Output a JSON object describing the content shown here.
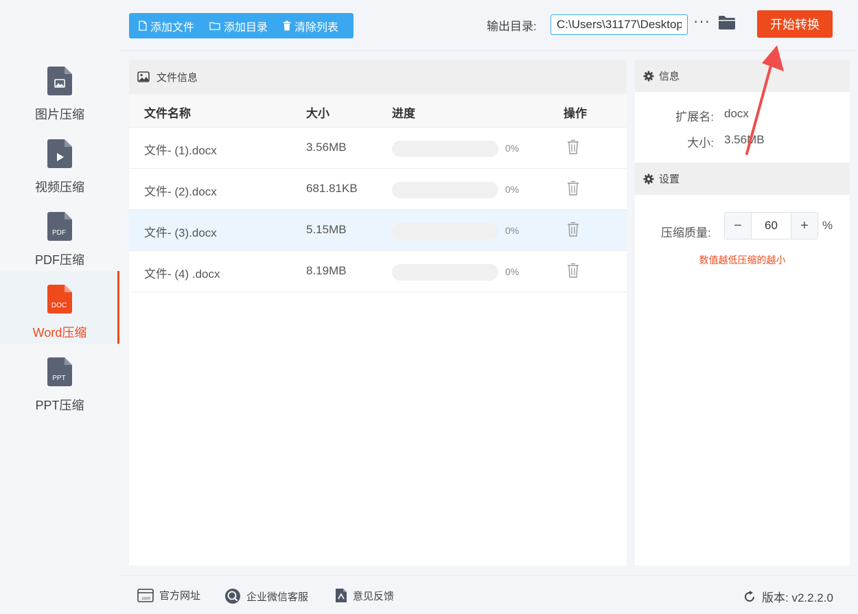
{
  "sidebar": {
    "items": [
      {
        "label": "图片压缩",
        "icon_text": "",
        "active": false
      },
      {
        "label": "视频压缩",
        "icon_text": "",
        "active": false
      },
      {
        "label": "PDF压缩",
        "icon_text": "PDF",
        "active": false
      },
      {
        "label": "Word压缩",
        "icon_text": "DOC",
        "active": true
      },
      {
        "label": "PPT压缩",
        "icon_text": "PPT",
        "active": false
      }
    ]
  },
  "toolbar": {
    "add_file": "添加文件",
    "add_dir": "添加目录",
    "clear_list": "清除列表",
    "output_label": "输出目录:",
    "output_value": "C:\\Users\\31177\\Desktop",
    "more": "···",
    "start": "开始转换"
  },
  "file_panel": {
    "title": "文件信息",
    "columns": {
      "name": "文件名称",
      "size": "大小",
      "progress": "进度",
      "action": "操作"
    },
    "rows": [
      {
        "name": "文件- (1).docx",
        "size": "3.56MB",
        "progress": 0,
        "pct": "0%"
      },
      {
        "name": "文件- (2).docx",
        "size": "681.81KB",
        "progress": 0,
        "pct": "0%"
      },
      {
        "name": "文件- (3).docx",
        "size": "5.15MB",
        "progress": 0,
        "pct": "0%"
      },
      {
        "name": "文件- (4) .docx",
        "size": "8.19MB",
        "progress": 0,
        "pct": "0%"
      }
    ]
  },
  "info_panel": {
    "title": "信息",
    "ext_label": "扩展名:",
    "ext_value": "docx",
    "size_label": "大小:",
    "size_value": "3.56MB"
  },
  "settings_panel": {
    "title": "设置",
    "quality_label": "压缩质量:",
    "minus": "−",
    "plus": "+",
    "quality_value": "60",
    "percent": "%",
    "hint": "数值越低压缩的越小"
  },
  "footer": {
    "website": "官方网址",
    "wechat": "企业微信客服",
    "feedback": "意见反馈",
    "version": "版本: v2.2.2.0"
  },
  "colors": {
    "accent_blue": "#3aa8f0",
    "accent_orange": "#ee4a1c",
    "icon_gray": "#5a6274"
  }
}
